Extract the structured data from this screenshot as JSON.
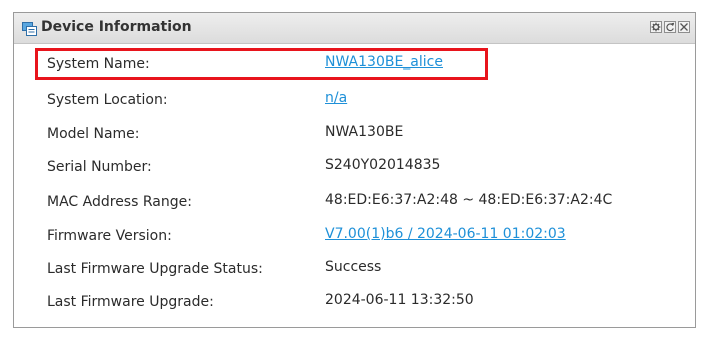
{
  "panel": {
    "title": "Device Information",
    "header_icon": "device-info-icon",
    "controls": [
      "settings-icon",
      "refresh-icon",
      "close-icon"
    ]
  },
  "rows": [
    {
      "label": "System Name:",
      "value": "NWA130BE_alice",
      "link": true
    },
    {
      "label": "System Location:",
      "value": "n/a",
      "link": true
    },
    {
      "label": "Model Name:",
      "value": "NWA130BE",
      "link": false
    },
    {
      "label": "Serial Number:",
      "value": "S240Y02014835",
      "link": false
    },
    {
      "label": "MAC Address Range:",
      "value": "48:ED:E6:37:A2:48 ~ 48:ED:E6:37:A2:4C",
      "link": false
    },
    {
      "label": "Firmware Version:",
      "value": "V7.00(1)b6 / 2024-06-11 01:02:03",
      "link": true
    },
    {
      "label": "Last Firmware Upgrade Status:",
      "value": "Success",
      "link": false
    },
    {
      "label": "Last Firmware Upgrade:",
      "value": "2024-06-11 13:32:50",
      "link": false
    }
  ],
  "colors": {
    "link": "#1e90d8",
    "highlight": "#e8141c",
    "text": "#2b2b2b"
  }
}
